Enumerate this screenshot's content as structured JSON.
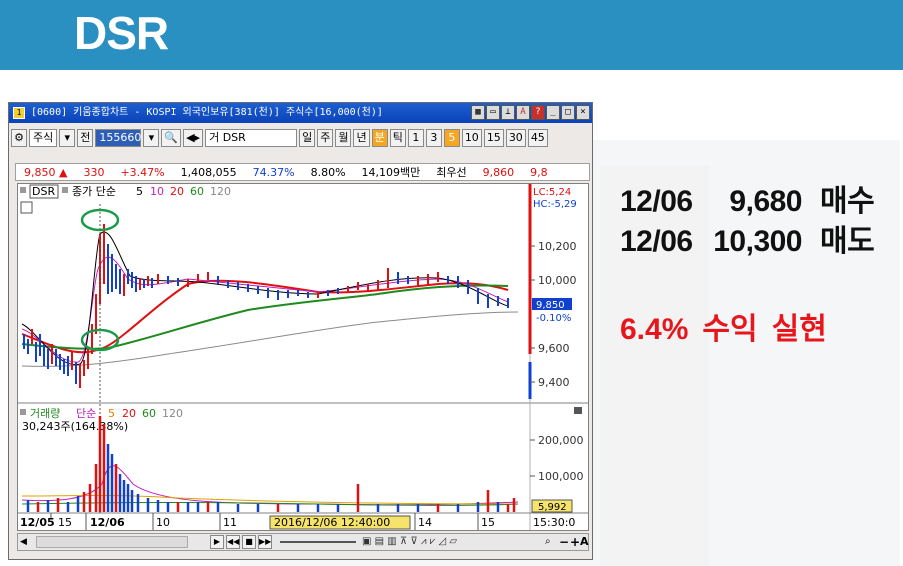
{
  "slide": {
    "title": "DSR"
  },
  "window": {
    "title": "[0600] 키움종합차트 - KOSPI 외국인보유[381(천)] 주식수[16,000(천)]",
    "toolbar": {
      "market": "주식",
      "mode": "전",
      "code": "155660",
      "type": "거",
      "name": "DSR",
      "periods": [
        "일",
        "주",
        "월",
        "년",
        "분",
        "틱",
        "1",
        "3",
        "5",
        "10",
        "15",
        "30",
        "45"
      ],
      "active_period": "5"
    },
    "info": {
      "price": "9,850",
      "arrow": "▲",
      "change": "330",
      "change_pct": "+3.47%",
      "volume": "1,408,055",
      "vol_ratio": "74.37%",
      "turnover": "8.80%",
      "amount": "14,109백만",
      "ask_label": "최우선",
      "ask_price": "9,860",
      "bid_price": "9,8"
    },
    "price_chart": {
      "legend_name": "DSR",
      "legend_ma_label": "종가 단순",
      "ma_periods": [
        "5",
        "10",
        "20",
        "60",
        "120"
      ],
      "lc_label": "LC:5,24",
      "hc_label": "HC:-5,29",
      "price_tag": "9,850",
      "pct_tag": "-0.10%",
      "y_ticks": [
        "10,200",
        "10,000",
        "9,600",
        "9,400"
      ]
    },
    "volume_chart": {
      "legend_name": "거래량",
      "legend_ma_label": "단순",
      "ma_periods": [
        "5",
        "20",
        "60",
        "120"
      ],
      "sub_text": "30,243주(164.38%)",
      "y_ticks": [
        "200,000",
        "100,000"
      ],
      "vol_tag": "5,992"
    },
    "x_axis": {
      "labels": [
        "12/05",
        "15",
        "12/06",
        "10",
        "11",
        "14",
        "15"
      ],
      "cursor_label": "2016/12/06 12:40:00",
      "end_time": "15:30:0"
    }
  },
  "trades": [
    {
      "date": "12/06",
      "price": "9,680",
      "side": "매수"
    },
    {
      "date": "12/06",
      "price": "10,300",
      "side": "매도"
    }
  ],
  "profit": {
    "pct": "6.4%",
    "label1": "수익",
    "label2": "실현"
  },
  "colors": {
    "header": "#2a8fc1",
    "candle_up": "#e01010",
    "candle_down": "#1040d0",
    "ma5": "#e01010",
    "ma20": "#1f8a1f",
    "ma120": "#8a8a8a",
    "highlight": "#1a9a4a"
  }
}
